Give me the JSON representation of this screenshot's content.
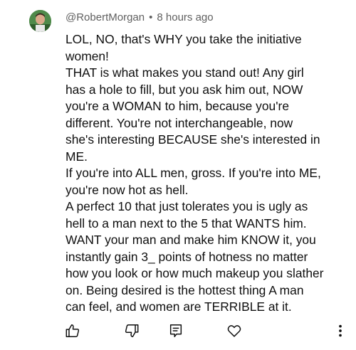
{
  "comment": {
    "author": "@RobertMorgan",
    "separator": "•",
    "timestamp": "8 hours ago",
    "lines": [
      "LOL, NO, that's WHY you take the initiative",
      "women!",
      "THAT is what makes you stand out! Any girl",
      "has a hole to fill, but you ask him out, NOW",
      "you're a WOMAN to him, because you're",
      "different. You're not interchangeable, now",
      "she's interesting BECAUSE she's interested in",
      "ME.",
      "If you're into ALL men, gross. If you're into ME,",
      "you're now hot as hell.",
      "A perfect 10 that just tolerates you is ugly as",
      "hell to a man next to the 5 that WANTS him.",
      "WANT your man and make him KNOW it, you",
      "instantly gain 3_ points of hotness no matter",
      "how you look or how much makeup you slather",
      "on. Being desired is the hottest thing A man",
      "can feel, and women are TERRIBLE at it."
    ]
  },
  "actions": [
    {
      "name": "like-button",
      "icon": "thumbs-up-icon"
    },
    {
      "name": "dislike-button",
      "icon": "thumbs-down-icon"
    },
    {
      "name": "reply-button",
      "icon": "comment-icon"
    },
    {
      "name": "heart-button",
      "icon": "heart-icon"
    },
    {
      "name": "more-options-button",
      "icon": "vertical-dots-icon"
    }
  ],
  "colors": {
    "text": "#0f0f0f",
    "meta": "#606060",
    "icon": "#0f0f0f",
    "avatar_bg": "#4f8a4a"
  }
}
